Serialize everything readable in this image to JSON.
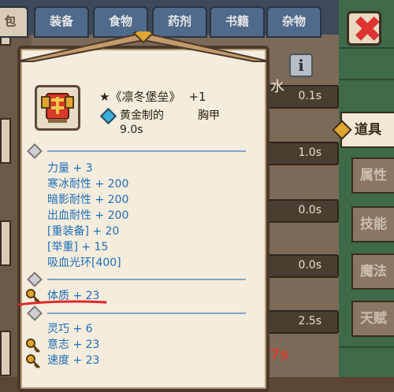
{
  "tabs": [
    "",
    "装备",
    "食物",
    "药剂",
    "书籍",
    "杂物"
  ],
  "side_tabs": [
    {
      "label": "道具",
      "active": true
    },
    {
      "label": "属性",
      "active": false
    },
    {
      "label": "技能",
      "active": false
    },
    {
      "label": "魔法",
      "active": false
    },
    {
      "label": "天赋",
      "active": false
    }
  ],
  "background_values": [
    "0.1s",
    "1.0s",
    "0.0s",
    "0.0s",
    "2.5s"
  ],
  "background_fragments": {
    "top_right": "水",
    "bottom": "7s",
    "left_edge": "包"
  },
  "info_label": "i",
  "item": {
    "star": "★",
    "name": "《凛冬堡垒》",
    "level": "+1",
    "quality": "黄金制的",
    "slot": "胸甲",
    "time": "9.0s"
  },
  "stats_group1": [
    "力量 + 3",
    "寒冰耐性 + 200",
    "暗影耐性 + 200",
    "出血耐性 + 200",
    "[重装备] + 20",
    "[举重] + 15",
    "吸血光环[400]"
  ],
  "stat_highlight": "体质 + 23",
  "stats_group2": [
    "灵巧 + 6",
    "意志 + 23",
    "速度 + 23"
  ],
  "colors": {
    "stat_text": "#1f6fb8",
    "popup_bg": "#f4ecdc",
    "highlight_underline": "#e0282a",
    "close_x": "#dd3333"
  }
}
